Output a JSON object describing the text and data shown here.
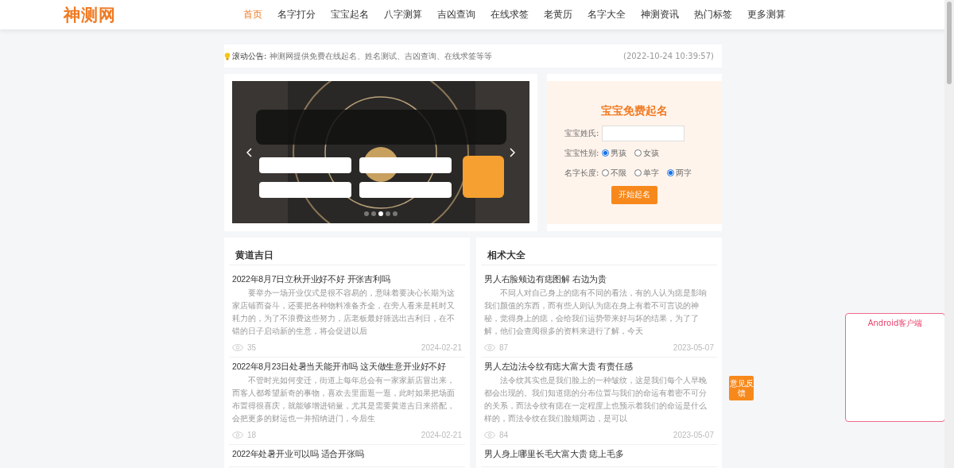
{
  "header": {
    "logo": "神测网",
    "nav": [
      {
        "label": "首页",
        "selected": true
      },
      {
        "label": "名字打分",
        "selected": false
      },
      {
        "label": "宝宝起名",
        "selected": false
      },
      {
        "label": "八字测算",
        "selected": false
      },
      {
        "label": "吉凶查询",
        "selected": false
      },
      {
        "label": "在线求签",
        "selected": false
      },
      {
        "label": "老黄历",
        "selected": false
      },
      {
        "label": "名字大全",
        "selected": false
      },
      {
        "label": "神测资讯",
        "selected": false
      },
      {
        "label": "热门标签",
        "selected": false
      },
      {
        "label": "更多测算",
        "selected": false
      }
    ]
  },
  "notice": {
    "label": "滚动公告:",
    "text": "神测网提供免费在线起名、姓名测试、吉凶查询、在线求签等等",
    "time": "(2022-10-24 10:39:57)"
  },
  "banner": {
    "kind": "picture",
    "dots": [
      {
        "selected": false
      },
      {
        "selected": false
      },
      {
        "selected": true
      },
      {
        "selected": false
      },
      {
        "selected": false
      }
    ]
  },
  "baby_form": {
    "title": "宝宝免费起名",
    "surname_label": "宝宝姓氏:",
    "gender_label": "宝宝性别:",
    "genders": [
      {
        "label": "男孩",
        "selected": true
      },
      {
        "label": "女孩",
        "selected": false
      }
    ],
    "length_label": "名字长度:",
    "lengths": [
      {
        "label": "不限",
        "selected": false
      },
      {
        "label": "单字",
        "selected": false
      },
      {
        "label": "两字",
        "selected": true
      }
    ],
    "submit": "开始起名"
  },
  "sections": [
    {
      "title": "黄道吉日",
      "articles": [
        {
          "title": "2022年8月7日立秋开业好不好 开张吉利吗",
          "excerpt": "要举办一场开业仪式是很不容易的，意味着要决心长期为这家店铺而奋斗，还要把各种物料准备齐全，在旁人看来是耗时又耗力的，为了不浪费这些努力，店老板最好筛选出吉利日，在不错的日子启动新的生意，将会促进以后",
          "views": "35",
          "date": "2024-02-21"
        },
        {
          "title": "2022年8月23日处暑当天能开市吗 这天做生意开业好不好",
          "excerpt": "不管时光如何变迁，街道上每年总会有一家家新店冒出来，而客人都希望新奇的事物，喜欢去里面逛一逛，此时如果把场面布置得很喜庆，就能够增进销量，尤其是需要黄道吉日来搭配，会把更多的财运也一并招纳进门，今后生",
          "views": "18",
          "date": "2024-02-21"
        },
        {
          "title": "2022年处暑开业可以吗 适合开张吗"
        }
      ]
    },
    {
      "title": "相术大全",
      "articles": [
        {
          "title": "男人右脸颊边有痣图解 右边为贵",
          "excerpt": "不同人对自己身上的痣有不同的看法，有的人认为痣是影响我们颜值的东西，而有些人则认为痣在身上有着不可言说的神秘，觉得身上的痣，会给我们运势带来好与坏的结果，为了了解，他们会查阅很多的资料来进行了解，今天",
          "views": "87",
          "date": "2023-05-07"
        },
        {
          "title": "男人左边法令纹有痣大富大贵 有责任感",
          "excerpt": "法令纹其实也是我们脸上的一种皱纹，这是我们每个人早晚都会出现的。我们知道痣的分布位置与我们的命运有着密不可分的关系，而法令纹有痣在一定程度上也预示着我们的命运是什么样的，而法令纹在我们脸颊两边，是可以",
          "views": "84",
          "date": "2023-05-07"
        },
        {
          "title": "男人身上哪里长毛大富大贵 痣上毛多"
        }
      ]
    }
  ],
  "feedback": "意见反馈",
  "app_box": {
    "title": "Android客户端"
  }
}
